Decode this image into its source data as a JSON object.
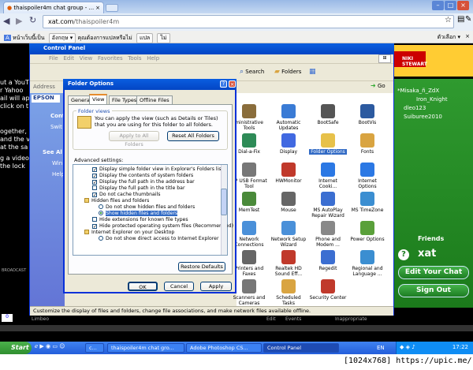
{
  "browser": {
    "tab_title": "thaispoiler4m chat group - ...",
    "url_host": "xat.com",
    "url_path": "/thaispoiler4m",
    "translate_bar": {
      "text": "หน้าเว็บนี้เป็น",
      "language": "อังกฤษ ▾",
      "question": "คุณต้องการแปลหรือไม่",
      "translate_button": "แปล",
      "no_button": "ไม่",
      "options": "ตัวเลือก ▾"
    }
  },
  "page": {
    "left_text": [
      "ut a YouT",
      "r Yahoo",
      "ail will ap",
      "click on t",
      "",
      "ogether,",
      "and the v",
      "at the sa",
      "",
      "g a video",
      "the lock"
    ],
    "broadcast": "BROADCAST",
    "ad_text": "NIKI STEWART",
    "xat_users": [
      "*Misaka_ñ_ZdX",
      "Iron_Knight",
      "dleo123",
      "Suiburee2010"
    ],
    "friends": "Friends",
    "xat_logo": "xat",
    "edit_chat": "Edit Your Chat",
    "sign_out": "Sign Out",
    "bottom_items": [
      "0",
      "Limbeo",
      "Edit",
      "Events",
      "Inappropriate"
    ]
  },
  "control_panel": {
    "title": "Control Panel",
    "menu": [
      "File",
      "Edit",
      "View",
      "Favorites",
      "Tools",
      "Help"
    ],
    "toolbar": {
      "back": "Back",
      "search": "Search",
      "folders": "Folders"
    },
    "address_label": "Address",
    "go": "Go",
    "sidebar": [
      "Contr",
      "Swit",
      "See Al",
      "Win",
      "Help"
    ],
    "epson": "EPSON",
    "icons": [
      {
        "label": "ministrative Tools",
        "color": "#8a6d3b"
      },
      {
        "label": "Automatic Updates",
        "color": "#3a7bd5"
      },
      {
        "label": "BootSafe",
        "color": "#555"
      },
      {
        "label": "BootVis",
        "color": "#2c5aa0"
      },
      {
        "label": "Dial-a-Fix",
        "color": "#2e8b57"
      },
      {
        "label": "Display",
        "color": "#4169e1"
      },
      {
        "label": "Folder Options",
        "color": "#e7c14a"
      },
      {
        "label": "Fonts",
        "color": "#d9a441"
      },
      {
        "label": "HP USB Format Tool",
        "color": "#777"
      },
      {
        "label": "HWMonitor",
        "color": "#c0392b"
      },
      {
        "label": "Internet Cooki...",
        "color": "#2b78e4"
      },
      {
        "label": "Internet Options",
        "color": "#2b78e4"
      },
      {
        "label": "MemTest",
        "color": "#4a8a3a"
      },
      {
        "label": "Mouse",
        "color": "#666"
      },
      {
        "label": "MS AutoPlay Repair Wizard",
        "color": "#3b6ed1"
      },
      {
        "label": "MS TimeZone",
        "color": "#3b8ed1"
      },
      {
        "label": "Network Connections",
        "color": "#4a90d9"
      },
      {
        "label": "Network Setup Wizard",
        "color": "#4a90d9"
      },
      {
        "label": "Phone and Modem ...",
        "color": "#888"
      },
      {
        "label": "Power Options",
        "color": "#5aa03a"
      },
      {
        "label": "Printers and Faxes",
        "color": "#666"
      },
      {
        "label": "Realtek HD Sound Eff...",
        "color": "#c0392b"
      },
      {
        "label": "Regedit",
        "color": "#3b6ed1"
      },
      {
        "label": "Regional and Language ...",
        "color": "#3b8ed1"
      },
      {
        "label": "Scanners and Cameras",
        "color": "#777"
      },
      {
        "label": "Scheduled Tasks",
        "color": "#d9a441"
      },
      {
        "label": "Security Center",
        "color": "#c0392b"
      }
    ],
    "status": "Customize the display of files and folders, change file associations, and make network files available offline."
  },
  "folder_options": {
    "title": "Folder Options",
    "tabs": [
      "General",
      "View",
      "File Types",
      "Offline Files"
    ],
    "folder_views_legend": "Folder views",
    "folder_views_desc": "You can apply the view (such as Details or Tiles) that you are using for this folder to all folders.",
    "apply_all": "Apply to All Folders",
    "reset_all": "Reset All Folders",
    "advanced_label": "Advanced settings:",
    "settings": [
      {
        "type": "check",
        "checked": true,
        "label": "Display simple folder view in Explorer's Folders list"
      },
      {
        "type": "check",
        "checked": true,
        "label": "Display the contents of system folders"
      },
      {
        "type": "check",
        "checked": true,
        "label": "Display the full path in the address bar"
      },
      {
        "type": "check",
        "checked": false,
        "label": "Display the full path in the title bar"
      },
      {
        "type": "check",
        "checked": true,
        "label": "Do not cache thumbnails"
      },
      {
        "type": "folder",
        "checked": false,
        "label": "Hidden files and folders"
      },
      {
        "type": "radio",
        "checked": false,
        "label": "Do not show hidden files and folders"
      },
      {
        "type": "radio",
        "checked": true,
        "label": "Show hidden files and folders",
        "selected": true
      },
      {
        "type": "check",
        "checked": false,
        "label": "Hide extensions for known file types"
      },
      {
        "type": "check",
        "checked": true,
        "label": "Hide protected operating system files (Recommended)"
      },
      {
        "type": "folder",
        "checked": false,
        "label": "Internet Explorer on your Desktop"
      },
      {
        "type": "radio",
        "checked": false,
        "label": "Do not show direct access to Internet Explorer"
      }
    ],
    "restore_defaults": "Restore Defaults",
    "ok": "OK",
    "cancel": "Cancel",
    "apply": "Apply"
  },
  "taskbar": {
    "start": "Start",
    "tasks": [
      "c...",
      "thaispoiler4m chat gro...",
      "Adobe Photoshop CS...",
      "Control Panel"
    ],
    "lang": "EN",
    "clock": "17:22"
  },
  "watermark": "[1024x768] https://upic.me/"
}
